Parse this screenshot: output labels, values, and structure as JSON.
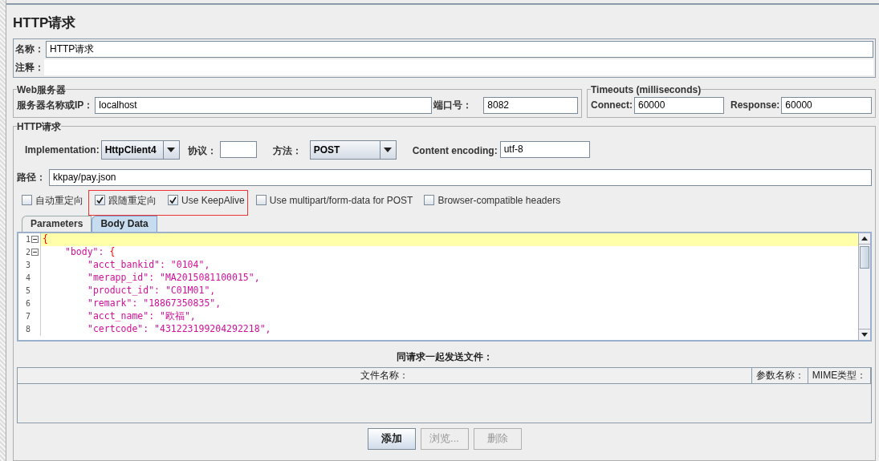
{
  "title": "HTTP请求",
  "name_field": {
    "label": "名称：",
    "value": "HTTP请求"
  },
  "comment_field": {
    "label": "注释："
  },
  "web_server": {
    "legend": "Web服务器",
    "server_label": "服务器名称或IP：",
    "server_value": "localhost",
    "port_label": "端口号：",
    "port_value": "8082"
  },
  "timeouts": {
    "legend": "Timeouts (milliseconds)",
    "connect_label": "Connect:",
    "connect_value": "60000",
    "response_label": "Response:",
    "response_value": "60000"
  },
  "http_request": {
    "legend": "HTTP请求",
    "implementation_label": "Implementation:",
    "implementation_value": "HttpClient4",
    "protocol_label": "协议：",
    "method_label": "方法：",
    "method_value": "POST",
    "encoding_label": "Content encoding:",
    "encoding_value": "utf-8",
    "path_label": "路径：",
    "path_value": "kkpay/pay.json",
    "options": [
      {
        "label": "自动重定向",
        "checked": false
      },
      {
        "label": "跟随重定向",
        "checked": true
      },
      {
        "label": "Use KeepAlive",
        "checked": true
      },
      {
        "label": "Use multipart/form-data for POST",
        "checked": false
      },
      {
        "label": "Browser-compatible headers",
        "checked": false
      }
    ],
    "tabs": [
      {
        "label": "Parameters",
        "selected": false
      },
      {
        "label": "Body Data",
        "selected": true
      }
    ],
    "body_lines": [
      {
        "number": "1",
        "fold": true,
        "current": true,
        "tokens": [
          {
            "kind": "brace",
            "text": "{"
          }
        ],
        "children": [
          {
            "number": "2",
            "fold": true,
            "current": false,
            "tokens": [
              {
                "kind": "string",
                "text": "\"body\": "
              },
              {
                "kind": "brace",
                "text": "{"
              }
            ],
            "children": [
              {
                "number": "3",
                "fold": false,
                "current": false,
                "tokens": [
                  {
                    "kind": "string",
                    "text": "\"acct_bankid\": \"0104\","
                  }
                ]
              },
              {
                "number": "4",
                "fold": false,
                "current": false,
                "tokens": [
                  {
                    "kind": "string",
                    "text": "\"merapp_id\": \"MA2015081100015\","
                  }
                ]
              },
              {
                "number": "5",
                "fold": false,
                "current": false,
                "tokens": [
                  {
                    "kind": "string",
                    "text": "\"product_id\": \"C01M01\","
                  }
                ]
              },
              {
                "number": "6",
                "fold": false,
                "current": false,
                "tokens": [
                  {
                    "kind": "string",
                    "text": "\"remark\": \"18867350835\","
                  }
                ]
              },
              {
                "number": "7",
                "fold": false,
                "current": false,
                "tokens": [
                  {
                    "kind": "string",
                    "text": "\"acct_name\": \"欧福\","
                  }
                ]
              },
              {
                "number": "8",
                "fold": false,
                "current": false,
                "tokens": [
                  {
                    "kind": "string",
                    "text": "\"certcode\": \"431223199204292218\","
                  }
                ]
              }
            ]
          }
        ]
      }
    ],
    "files_title": "同请求一起发送文件：",
    "files_columns": [
      "文件名称：",
      "参数名称：",
      "MIME类型："
    ],
    "buttons": [
      {
        "label": "添加",
        "disabled": false
      },
      {
        "label": "浏览...",
        "disabled": true
      },
      {
        "label": "删除",
        "disabled": true
      }
    ]
  }
}
